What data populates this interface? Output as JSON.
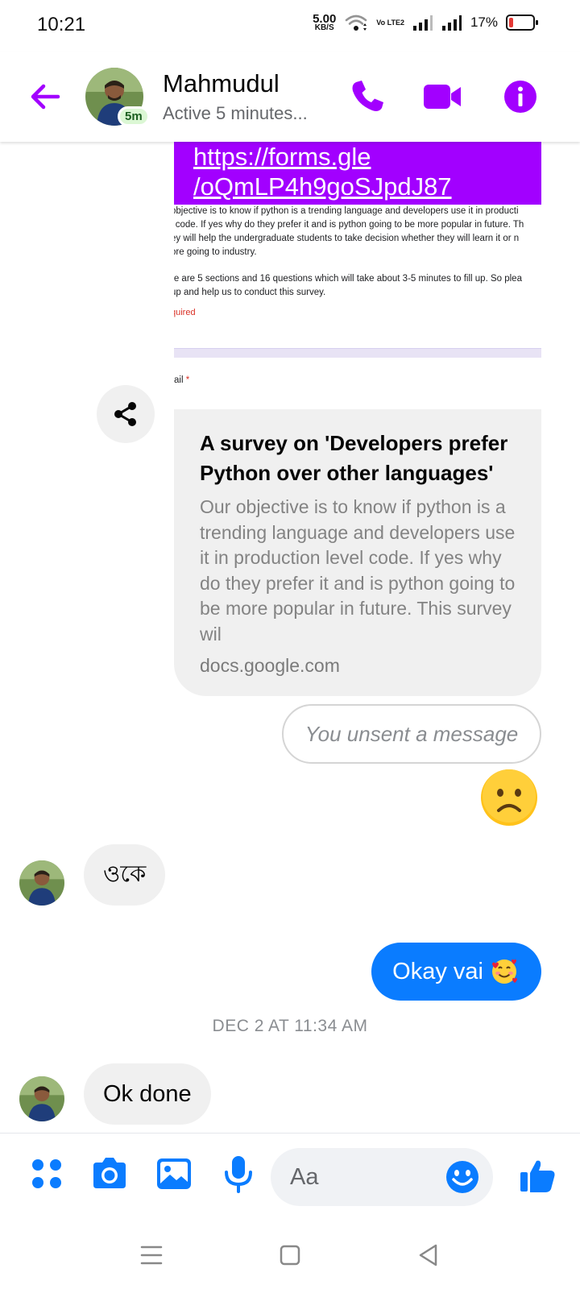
{
  "status_bar": {
    "time": "10:21",
    "net_speed_value": "5.00",
    "net_speed_unit": "KB/S",
    "volte_label": "Vo LTE2",
    "battery_percent": "17%",
    "battery_level": 0.17,
    "battery_color": "#e53935"
  },
  "header": {
    "contact_name": "Mahmudul",
    "active_status": "Active 5 minutes...",
    "active_badge": "5m",
    "accent_color": "#a200ff",
    "icons": [
      "back-arrow-icon",
      "phone-icon",
      "video-camera-icon",
      "info-icon"
    ]
  },
  "messages": {
    "link_line1": "https://forms.gle",
    "link_line2": "/oQmLP4h9goSJpdJ87",
    "link_bubble_color": "#a200ff",
    "preview": {
      "line1": "objective is to know if python is a trending language and developers use it in producti",
      "line2": "l code. If yes why do they prefer it and is python going to be more popular in future. Th",
      "line3": "ey will help the undergraduate students to take decision whether they will learn it or n",
      "line4": "ore going to industry.",
      "line5": "re are 5 sections and 16 questions which will take about 3-5 minutes to fill up. So plea",
      "line6": "up and help us to conduct this survey.",
      "required": "quired",
      "email_label": "ail",
      "asterisk": "*"
    },
    "card": {
      "title": "A survey on 'Developers prefer Python over other languages'",
      "description": "Our objective is to know if python is a trending language and developers use it in production level code. If yes why do they prefer it and is python going to be more popular in future. This survey wil",
      "domain": "docs.google.com"
    },
    "unsent_text": "You unsent a message",
    "incoming_1": "ওকে",
    "outgoing_1": "Okay vai",
    "outgoing_color": "#0a7cff",
    "timestamp": "DEC 2 AT 11:34 AM",
    "incoming_2": "Ok done"
  },
  "composer": {
    "placeholder": "Aa",
    "icon_color": "#0a7cff",
    "icons": [
      "menu-dots-icon",
      "camera-icon",
      "gallery-icon",
      "microphone-icon",
      "emoji-icon",
      "thumbs-up-icon"
    ]
  },
  "navbar": {
    "icons": [
      "recent-apps-icon",
      "home-icon",
      "back-icon"
    ]
  }
}
